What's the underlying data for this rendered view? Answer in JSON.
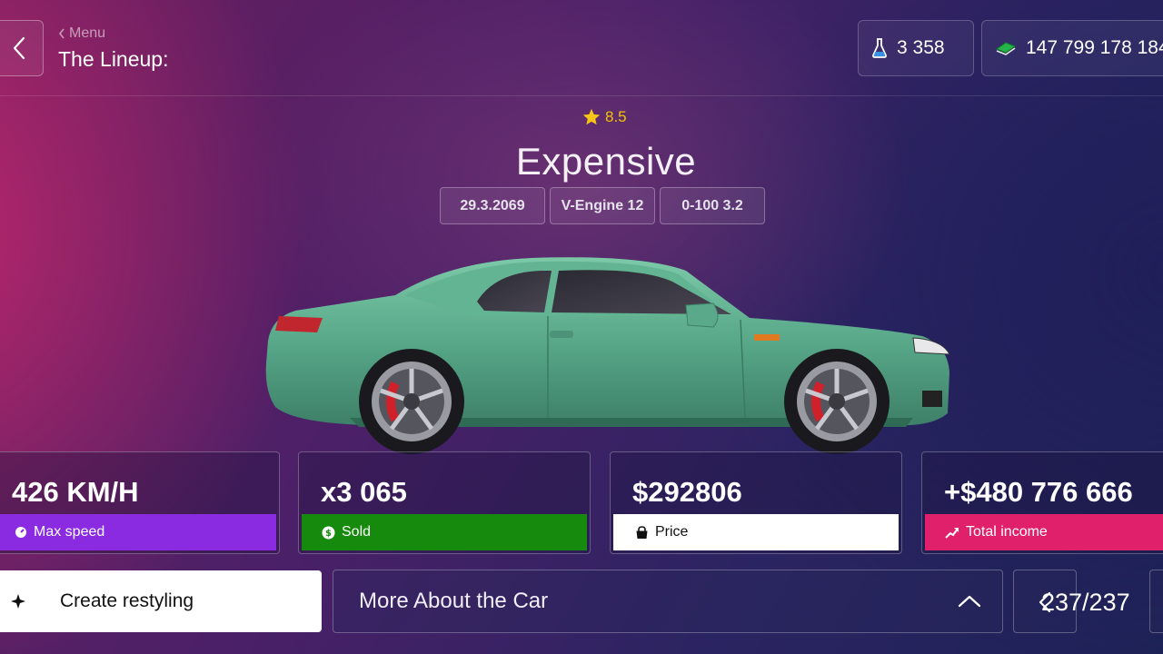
{
  "header": {
    "breadcrumb": "Menu",
    "title": "The Lineup:"
  },
  "resources": {
    "flask_count": "3 358",
    "cash_amount": "147 799 178 184"
  },
  "car": {
    "rating": "8.5",
    "name": "Expensive",
    "specs": [
      "29.3.2069",
      "V-Engine 12",
      "0-100 3.2"
    ],
    "body_color": "#5aa98a"
  },
  "stats": [
    {
      "value": "426 KM/H",
      "label": "Max speed",
      "color": "#8a2be2",
      "icon": "speedometer-icon"
    },
    {
      "value": "x3 065",
      "label": "Sold",
      "color": "#168a0c",
      "icon": "dollar-coin-icon"
    },
    {
      "value": "$292806",
      "label": "Price",
      "color": "#ffffff",
      "icon": "shopping-bag-icon"
    },
    {
      "value": "+$480 776 666",
      "label": "Total income",
      "color": "#e0206a",
      "icon": "trend-up-icon"
    }
  ],
  "actions": {
    "restyle_label": "Create restyling",
    "more_label": "More About the Car"
  },
  "pager": {
    "text": "237/237"
  }
}
